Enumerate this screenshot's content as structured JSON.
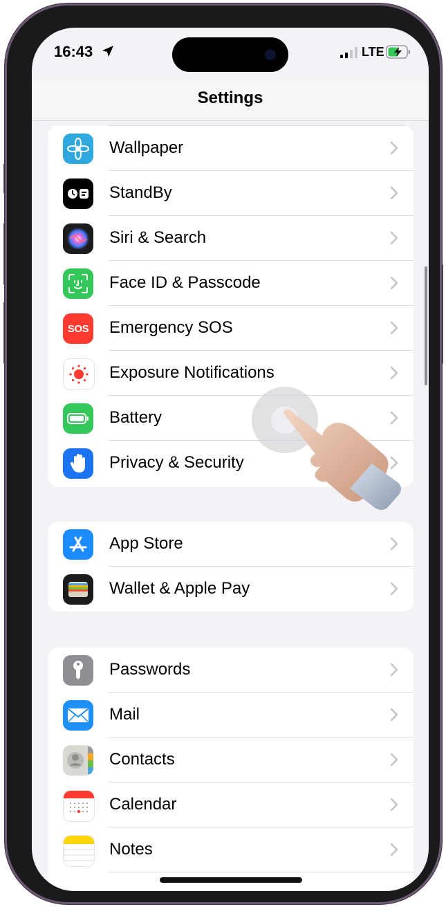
{
  "status_bar": {
    "time": "16:43",
    "network": "LTE"
  },
  "nav": {
    "title": "Settings"
  },
  "groups": [
    {
      "items": [
        {
          "label": "Wallpaper",
          "icon": "wallpaper-icon",
          "color": "#2FA8DF"
        },
        {
          "label": "StandBy",
          "icon": "standby-icon",
          "color": "#000000"
        },
        {
          "label": "Siri & Search",
          "icon": "siri-icon",
          "color": "#1C1C1E"
        },
        {
          "label": "Face ID & Passcode",
          "icon": "face-id-icon",
          "color": "#34C759"
        },
        {
          "label": "Emergency SOS",
          "icon": "sos-icon",
          "color": "#FF3B30",
          "glyph": "SOS"
        },
        {
          "label": "Exposure Notifications",
          "icon": "exposure-icon",
          "color": "#FFFFFF"
        },
        {
          "label": "Battery",
          "icon": "battery-icon",
          "color": "#34C759"
        },
        {
          "label": "Privacy & Security",
          "icon": "hand-icon",
          "color": "#1A73F0"
        }
      ]
    },
    {
      "items": [
        {
          "label": "App Store",
          "icon": "app-store-icon",
          "color": "#1A8CFF"
        },
        {
          "label": "Wallet & Apple Pay",
          "icon": "wallet-icon",
          "color": "#1C1C1E"
        }
      ]
    },
    {
      "items": [
        {
          "label": "Passwords",
          "icon": "key-icon",
          "color": "#8E8E93"
        },
        {
          "label": "Mail",
          "icon": "mail-icon",
          "color": "#1E90F5"
        },
        {
          "label": "Contacts",
          "icon": "contacts-icon",
          "color": "#D8D8D2"
        },
        {
          "label": "Calendar",
          "icon": "calendar-icon",
          "color": "#FFFFFF"
        },
        {
          "label": "Notes",
          "icon": "notes-icon",
          "color": "#FFFFFF"
        }
      ]
    }
  ]
}
